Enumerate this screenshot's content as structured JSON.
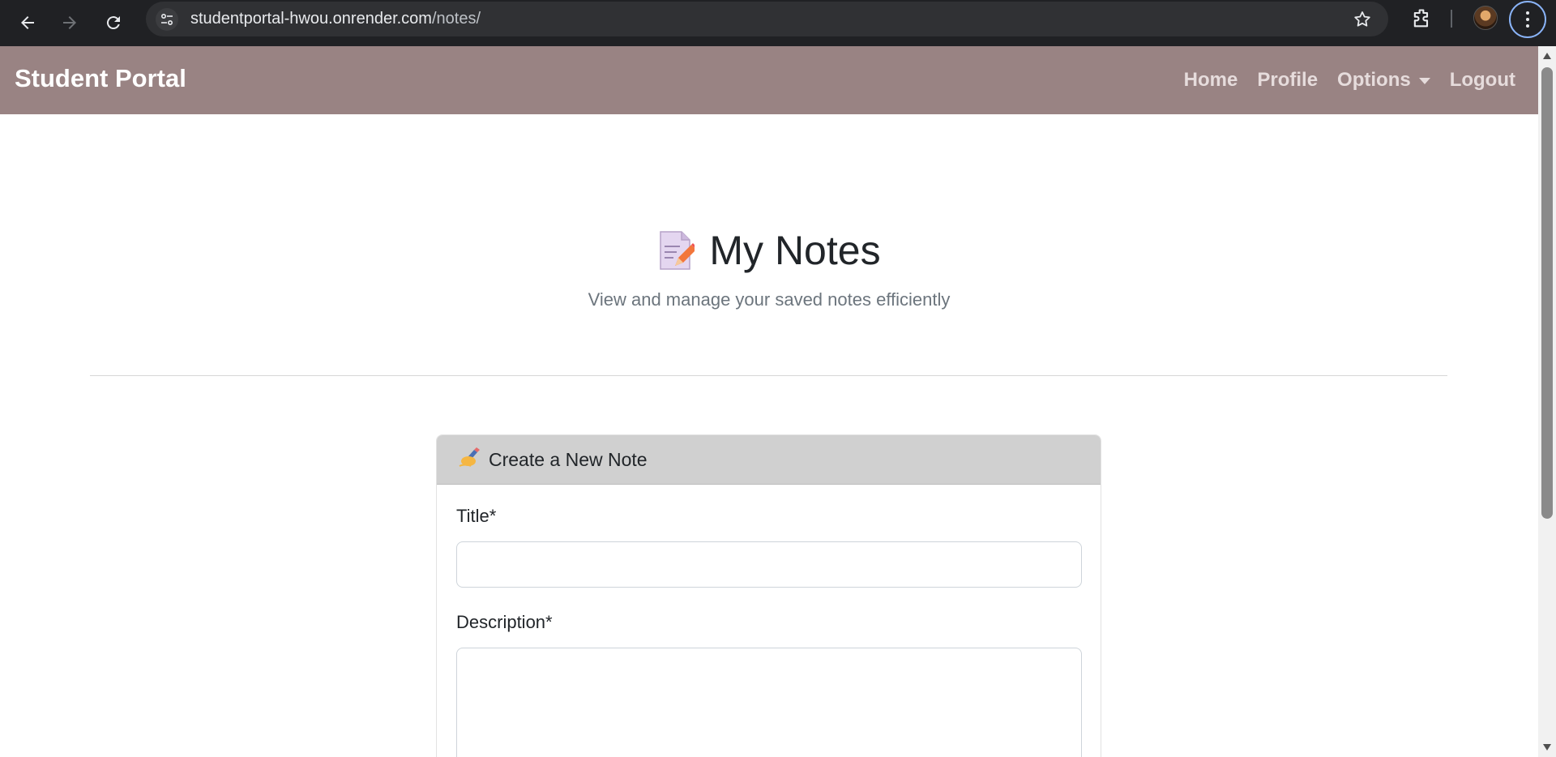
{
  "browser": {
    "url_host": "studentportal-hwou.onrender.com",
    "url_path": "/notes/"
  },
  "navbar": {
    "brand": "Student Portal",
    "links": [
      {
        "label": "Home"
      },
      {
        "label": "Profile"
      },
      {
        "label": "Options"
      },
      {
        "label": "Logout"
      }
    ],
    "background_color": "#998383"
  },
  "header": {
    "title": "My Notes",
    "title_icon": "memo-icon",
    "subtitle": "View and manage your saved notes efficiently"
  },
  "note_form": {
    "card_title": "Create a New Note",
    "card_title_icon": "writing-hand-icon",
    "title_label": "Title*",
    "title_value": "",
    "description_label": "Description*",
    "description_value": ""
  }
}
